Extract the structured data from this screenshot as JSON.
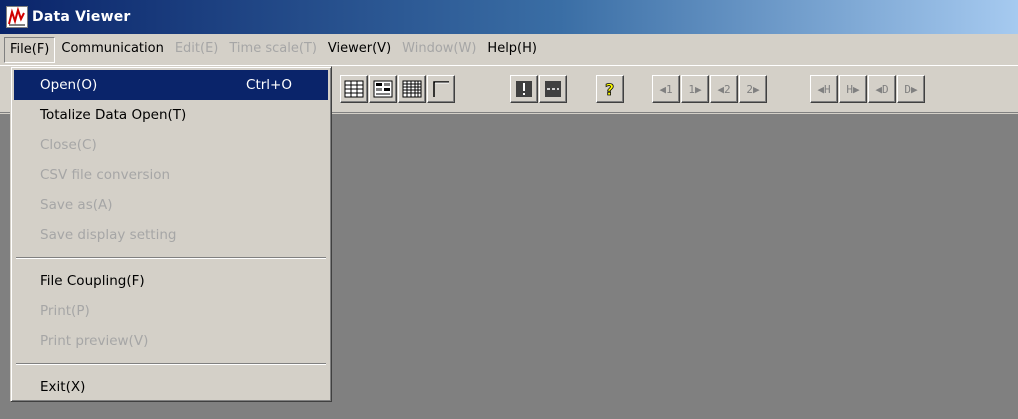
{
  "window": {
    "title": "Data Viewer",
    "icon": "chart-line-icon",
    "title_bar_color": "#0a246a",
    "workspace_color": "#808080"
  },
  "menu": {
    "items": [
      {
        "label": "File(F)",
        "enabled": true,
        "active": true
      },
      {
        "label": "Communication",
        "enabled": true,
        "active": false
      },
      {
        "label": "Edit(E)",
        "enabled": false,
        "active": false
      },
      {
        "label": "Time scale(T)",
        "enabled": false,
        "active": false
      },
      {
        "label": "Viewer(V)",
        "enabled": true,
        "active": false
      },
      {
        "label": "Window(W)",
        "enabled": false,
        "active": false
      },
      {
        "label": "Help(H)",
        "enabled": true,
        "active": false
      }
    ]
  },
  "file_menu": {
    "items": [
      {
        "label": "Open(O)",
        "shortcut": "Ctrl+O",
        "enabled": true,
        "highlighted": true
      },
      {
        "label": "Totalize Data Open(T)",
        "enabled": true
      },
      {
        "label": "Close(C)",
        "enabled": false
      },
      {
        "label": "CSV file conversion",
        "enabled": false
      },
      {
        "label": "Save as(A)",
        "enabled": false
      },
      {
        "label": "Save display setting",
        "enabled": false
      },
      {
        "label": "File Coupling(F)",
        "enabled": true
      },
      {
        "label": "Print(P)",
        "enabled": false
      },
      {
        "label": "Print preview(V)",
        "enabled": false
      },
      {
        "label": "Exit(X)",
        "enabled": true
      }
    ],
    "highlight_color": "#0a246a"
  },
  "toolbar": {
    "buttons": [
      {
        "name": "table-view-icon"
      },
      {
        "name": "data-list-icon"
      },
      {
        "name": "grid-view-icon"
      },
      {
        "name": "axis-view-icon"
      },
      {
        "name": "info-icon"
      },
      {
        "name": "scale-icon"
      },
      {
        "name": "help-icon"
      },
      {
        "name": "marker-1-left-icon",
        "text": "1"
      },
      {
        "name": "marker-1-right-icon",
        "text": "1"
      },
      {
        "name": "marker-2-left-icon",
        "text": "2"
      },
      {
        "name": "marker-2-right-icon",
        "text": "2"
      },
      {
        "name": "hour-left-icon",
        "text": "H"
      },
      {
        "name": "hour-right-icon",
        "text": "H"
      },
      {
        "name": "day-left-icon",
        "text": "D"
      },
      {
        "name": "day-right-icon",
        "text": "D"
      }
    ]
  }
}
